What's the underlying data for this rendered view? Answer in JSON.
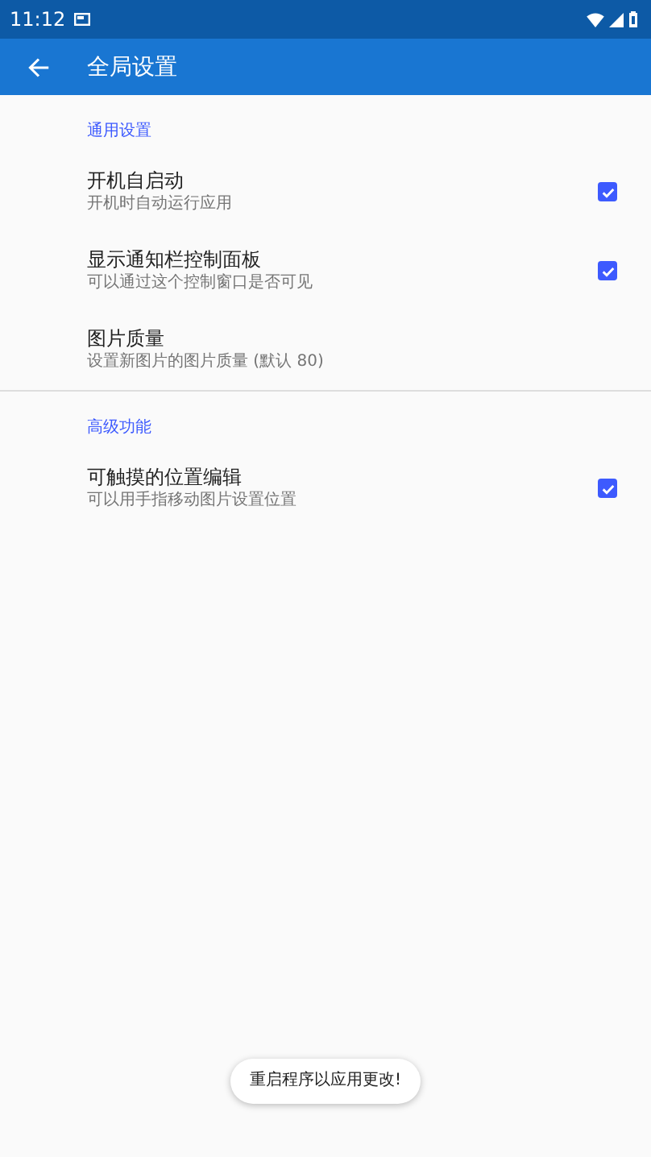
{
  "status_bar": {
    "time": "11:12"
  },
  "app_bar": {
    "title": "全局设置"
  },
  "sections": [
    {
      "header": "通用设置",
      "items": [
        {
          "kind": "checkbox",
          "title": "开机自启动",
          "subtitle": "开机时自动运行应用",
          "checked": true
        },
        {
          "kind": "checkbox",
          "title": "显示通知栏控制面板",
          "subtitle": "可以通过这个控制窗口是否可见",
          "checked": true
        },
        {
          "kind": "plain",
          "title": "图片质量",
          "subtitle": "设置新图片的图片质量 (默认 80)"
        }
      ]
    },
    {
      "header": "高级功能",
      "items": [
        {
          "kind": "checkbox",
          "title": "可触摸的位置编辑",
          "subtitle": "可以用手指移动图片设置位置",
          "checked": true
        }
      ]
    }
  ],
  "toast": "重启程序以应用更改!"
}
